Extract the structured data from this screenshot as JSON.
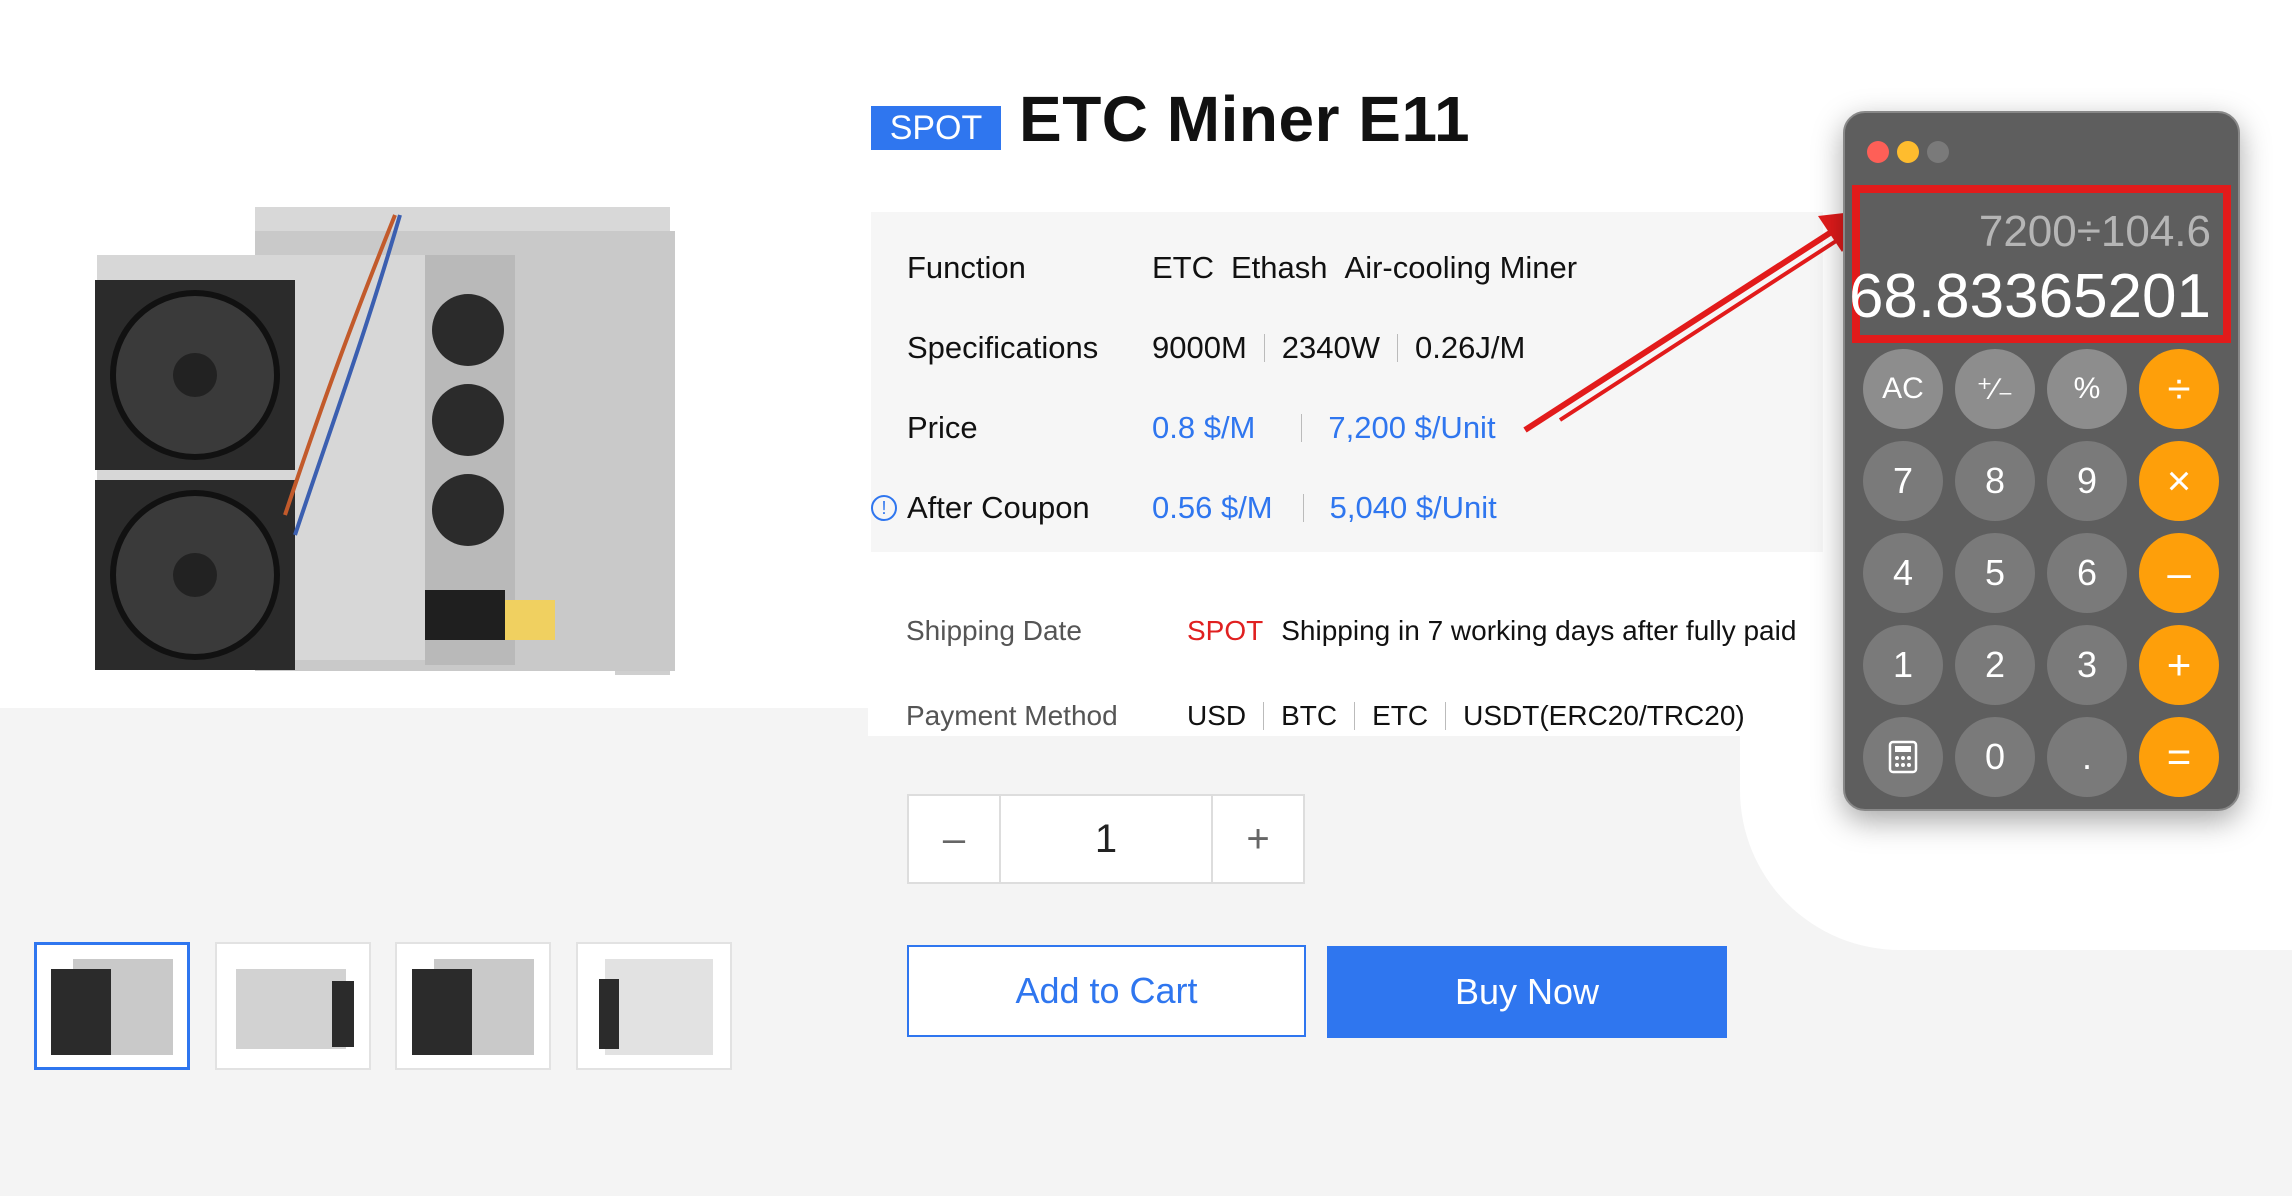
{
  "product": {
    "badge": "SPOT",
    "title": "ETC Miner E11",
    "specs": {
      "function_label": "Function",
      "function_values": [
        "ETC",
        "Ethash",
        "Air-cooling Miner"
      ],
      "specifications_label": "Specifications",
      "specifications_values": [
        "9000M",
        "2340W",
        "0.26J/M"
      ],
      "price_label": "Price",
      "price_values": [
        "0.8 $/M",
        "7,200 $/Unit"
      ],
      "coupon_label": "After Coupon",
      "coupon_values": [
        "0.56 $/M",
        "5,040 $/Unit"
      ]
    },
    "shipping": {
      "label": "Shipping Date",
      "tag": "SPOT",
      "text": "Shipping in 7 working days after fully paid"
    },
    "payment": {
      "label": "Payment Method",
      "methods": [
        "USD",
        "BTC",
        "ETC",
        "USDT(ERC20/TRC20)"
      ]
    },
    "quantity": {
      "minus": "–",
      "value": "1",
      "plus": "+"
    },
    "buttons": {
      "add_to_cart": "Add to Cart",
      "buy_now": "Buy Now"
    },
    "thumbnails_count": 4
  },
  "calculator": {
    "expression": "7200÷104.6",
    "result": "68.83365201",
    "keys": [
      [
        "AC",
        "⁺∕₋",
        "%",
        "÷"
      ],
      [
        "7",
        "8",
        "9",
        "×"
      ],
      [
        "4",
        "5",
        "6",
        "–"
      ],
      [
        "1",
        "2",
        "3",
        "+"
      ],
      [
        "calculator-icon",
        "0",
        ".",
        "="
      ]
    ]
  },
  "colors": {
    "accent": "#2f76ef",
    "spot_red": "#e02020",
    "calc_orange": "#fe9f0a",
    "annotation_red": "#e21b1b"
  }
}
